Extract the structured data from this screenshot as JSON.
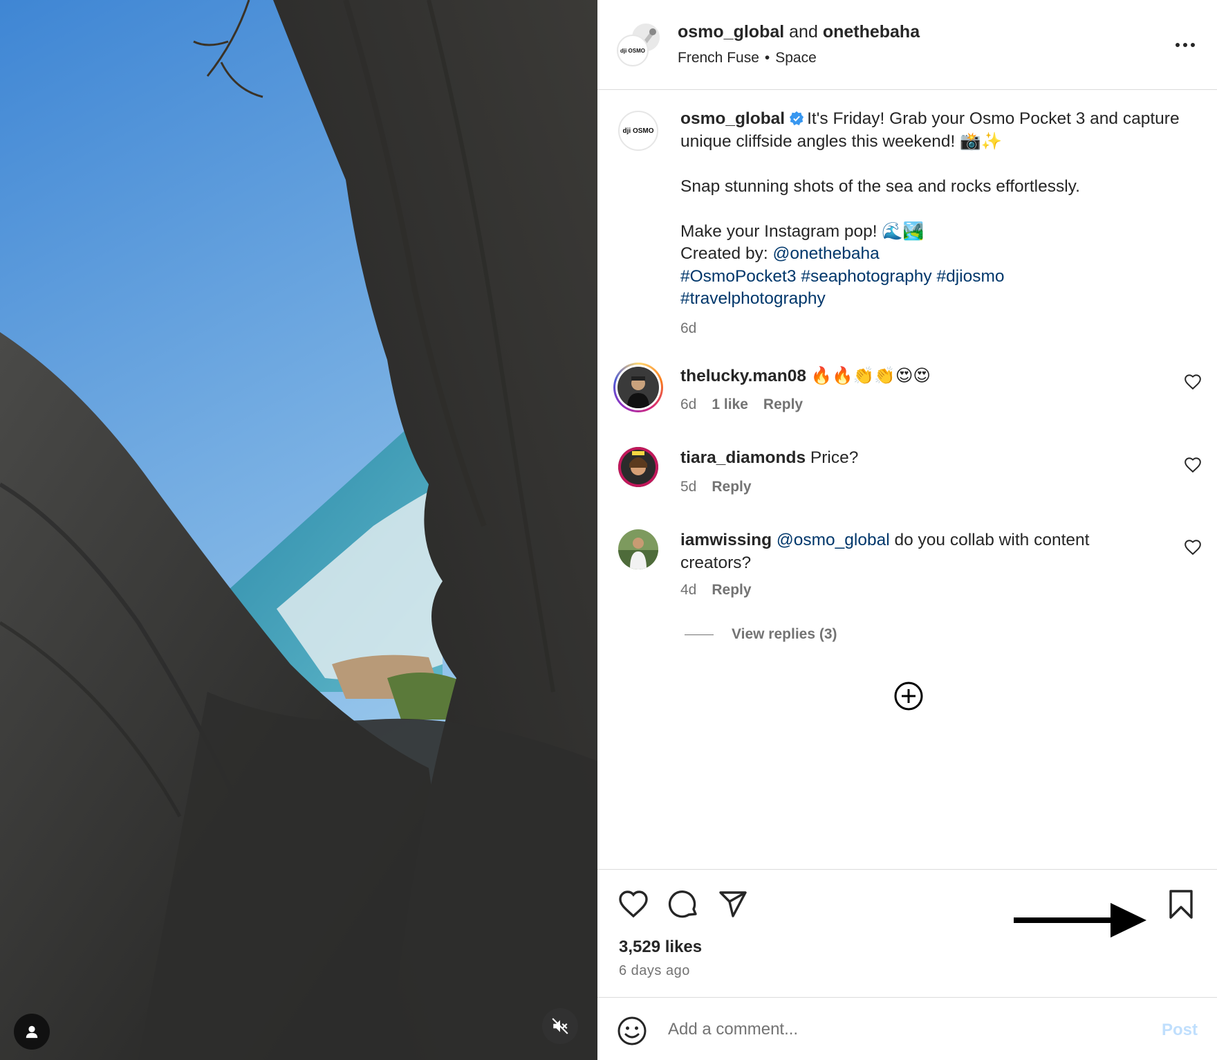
{
  "header": {
    "user1": "osmo_global",
    "joiner": "and",
    "user2": "onethebaha",
    "audio_artist": "French Fuse",
    "audio_separator": "•",
    "audio_track": "Space",
    "avatar_logo": "dji OSMO",
    "more_icon": "more-horizontal-icon"
  },
  "caption": {
    "username": "osmo_global",
    "line1": "It's Friday! Grab your Osmo Pocket 3 and capture unique cliffside angles this weekend! 📸✨",
    "line2": "Snap stunning shots of the sea and rocks effortlessly.",
    "line3": "Make your Instagram pop! 🌊🏞️",
    "created_by_label": "Created by:",
    "created_by_mention": "@onethebaha",
    "hashtag1": "#OsmoPocket3",
    "hashtag2": "#seaphotography",
    "hashtag3": "#djiosmo",
    "hashtag4": "#travelphotography",
    "time": "6d",
    "avatar_logo": "dji OSMO"
  },
  "comments": [
    {
      "username": "thelucky.man08",
      "text": "🔥🔥👏👏😍😍",
      "time": "6d",
      "likes": "1 like",
      "reply": "Reply"
    },
    {
      "username": "tiara_diamonds",
      "text": "Price?",
      "time": "5d",
      "reply": "Reply"
    },
    {
      "username": "iamwissing",
      "mention": "@osmo_global",
      "text": "do you collab with content creators?",
      "time": "4d",
      "reply": "Reply",
      "view_replies": "View replies (3)"
    }
  ],
  "actions": {
    "likes": "3,529 likes",
    "posted": "6 days ago"
  },
  "add_comment": {
    "placeholder": "Add a comment...",
    "post_label": "Post"
  },
  "colors": {
    "link": "#00376b",
    "muted": "#737373",
    "verified": "#3897f0",
    "post_disabled": "#c0dffd",
    "divider": "#dbdbdb"
  }
}
